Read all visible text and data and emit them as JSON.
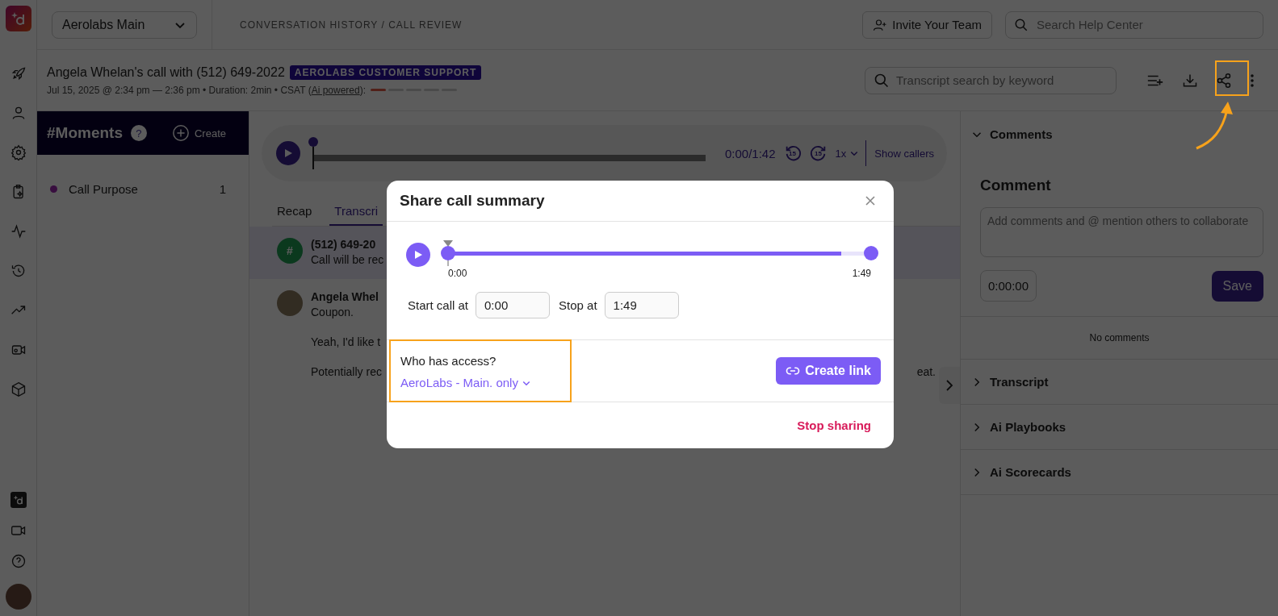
{
  "workspace_select": {
    "value": "Aerolabs Main"
  },
  "breadcrumb": "CONVERSATION HISTORY / CALL REVIEW",
  "invite_button": "Invite Your Team",
  "help_search": {
    "placeholder": "Search Help Center"
  },
  "call": {
    "title": "Angela Whelan's call with (512) 649-2022",
    "tag": "AEROLABS CUSTOMER SUPPORT",
    "meta": "Jul 15, 2025 @ 2:34 pm — 2:36 pm • Duration: 2min • CSAT (",
    "csat_link": "Ai powered",
    "csat_suffix": "):",
    "csat": {
      "level": 0.2
    }
  },
  "transcript_search": {
    "placeholder": "Transcript search by keyword"
  },
  "moments": {
    "title": "#Moments",
    "help": "?",
    "create": "Create",
    "items": [
      {
        "label": "Call Purpose",
        "count": "1",
        "color": "#380e3f"
      }
    ]
  },
  "player": {
    "time": "0:00/1:42",
    "skip_back": "15",
    "skip_forward": "15",
    "speed": "1x",
    "show_callers": "Show callers"
  },
  "tabs": [
    {
      "label": "Recap",
      "selected": false
    },
    {
      "label": "Transcri",
      "selected": true
    }
  ],
  "transcript": [
    {
      "kind": "hash",
      "avatar": "#",
      "speaker": "(512) 649-20",
      "highlighted": true,
      "lines": [
        {
          "text": "Call will be rec"
        }
      ]
    },
    {
      "kind": "photo",
      "speaker": "Angela Whel",
      "highlighted": false,
      "lines": [
        {
          "text": "Coupon."
        },
        {
          "text": "Yeah, I'd like t"
        },
        {
          "text": "Potentially rec",
          "tail": "eat."
        }
      ]
    }
  ],
  "comments": {
    "title": "Comments",
    "expanded": true,
    "heading": "Comment",
    "input": {
      "placeholder": "Add comments and @ mention others to collaborate"
    },
    "timestamp": "0:00:00",
    "save": "Save",
    "empty": "No comments"
  },
  "sections": [
    {
      "label": "Transcript",
      "expanded": false
    },
    {
      "label": "Ai Playbooks",
      "expanded": false
    },
    {
      "label": "Ai Scorecards",
      "expanded": false
    }
  ],
  "modal": {
    "title": "Share call summary",
    "level": 0.93,
    "start_tick": "0:00",
    "end_tick": "1:49",
    "start_label": "Start call at",
    "start_value": "0:00",
    "stop_label": "Stop at",
    "stop_value": "1:49",
    "access_label": "Who has access?",
    "access_value": "AeroLabs - Main. only",
    "create_link": "Create link",
    "stop_sharing": "Stop sharing"
  }
}
